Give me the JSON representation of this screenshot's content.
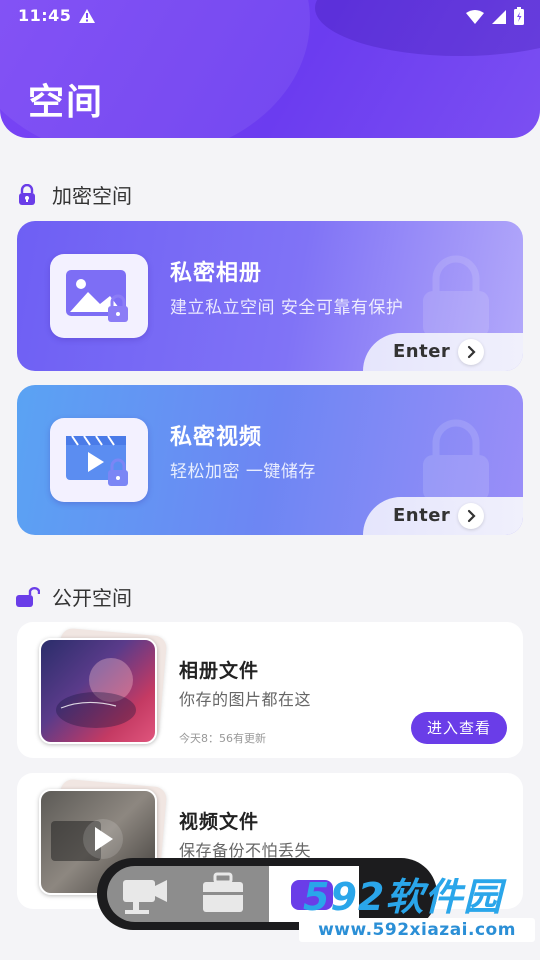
{
  "status_bar": {
    "time": "11:45"
  },
  "header": {
    "title": "空间"
  },
  "sections": {
    "private": {
      "title": "加密空间"
    },
    "public": {
      "title": "公开空间"
    }
  },
  "private_cards": [
    {
      "title": "私密相册",
      "subtitle": "建立私立空间 安全可靠有保护",
      "button": "Enter",
      "icon": "image-lock-icon"
    },
    {
      "title": "私密视频",
      "subtitle": "轻松加密 一键储存",
      "button": "Enter",
      "icon": "video-lock-icon"
    }
  ],
  "public_cards": [
    {
      "title": "相册文件",
      "subtitle": "你存的图片都在这",
      "updated": "今天8：56有更新",
      "button": "进入查看"
    },
    {
      "title": "视频文件",
      "subtitle": "保存备份不怕丢失"
    }
  ],
  "watermark": {
    "title": "592软件园",
    "url": "www.592xiazai.com"
  },
  "colors": {
    "accent": "#6a3de8",
    "header": "#7a45f5",
    "watermark": "#2aa6ea"
  }
}
